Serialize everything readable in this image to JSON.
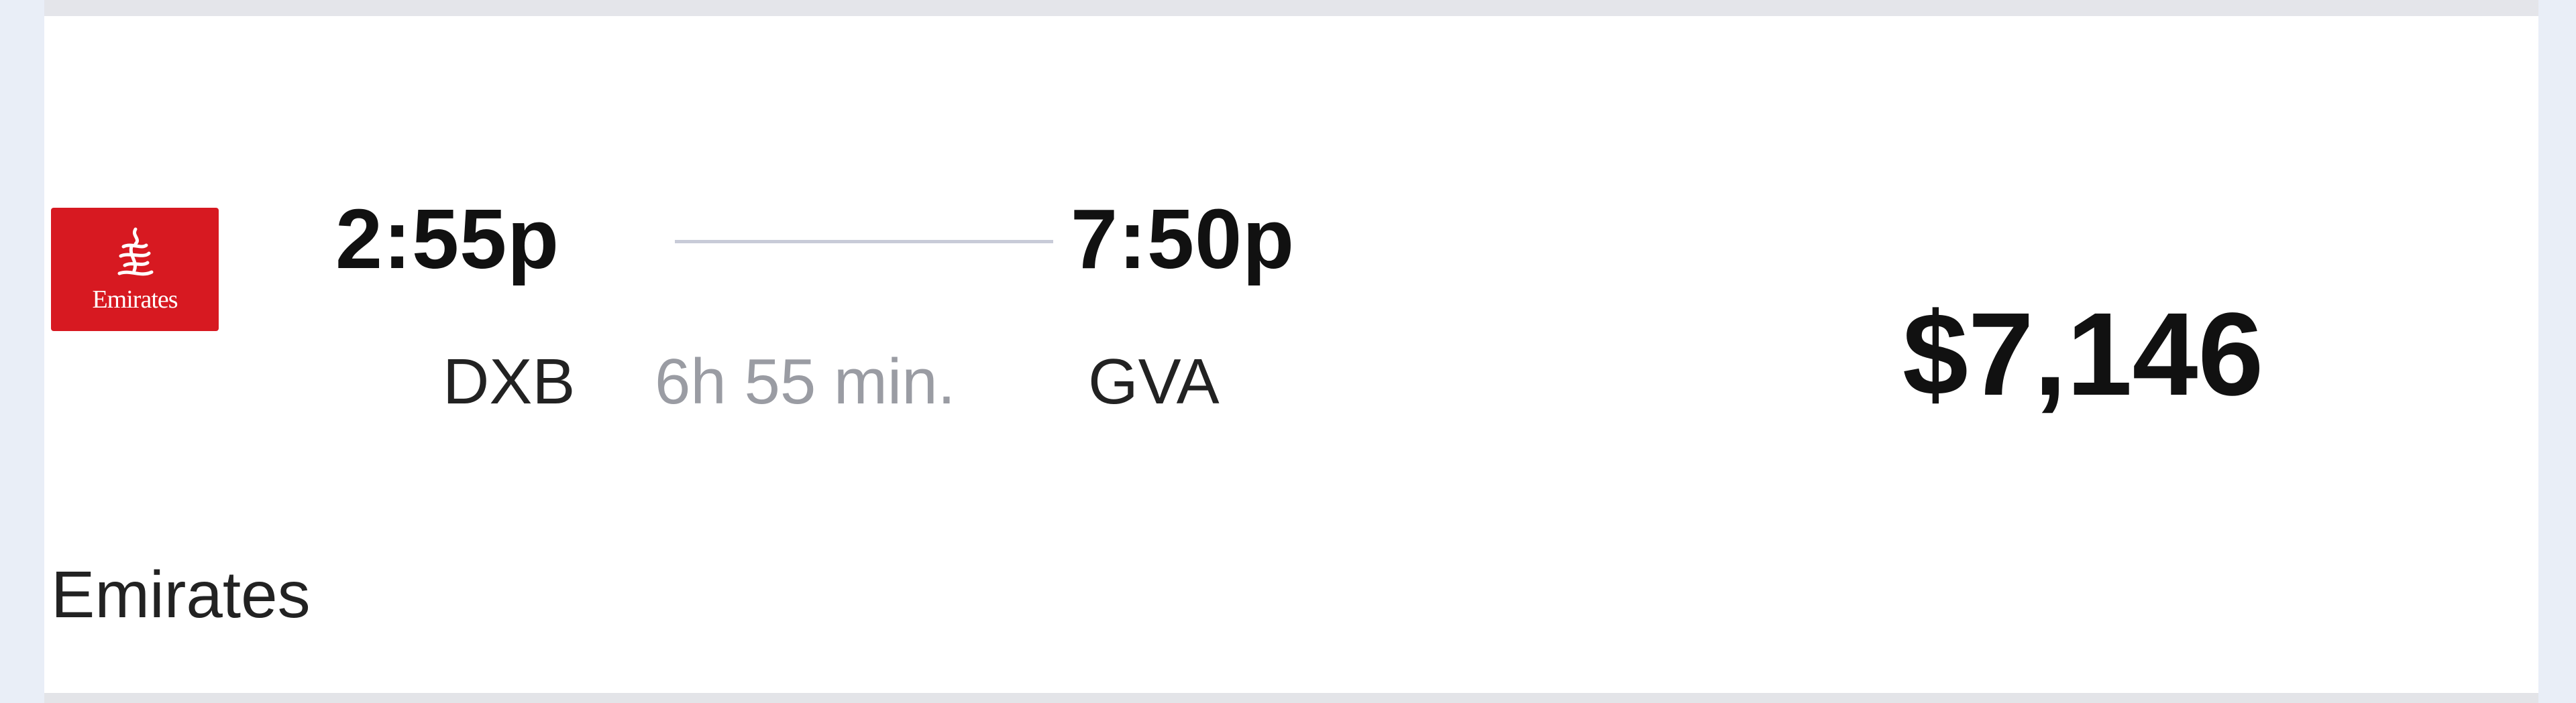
{
  "flight": {
    "logo": {
      "text": "Emirates",
      "icon": "emirates-logo",
      "background": "#d71921"
    },
    "departure": {
      "time": "2:55p",
      "airport": "DXB"
    },
    "arrival": {
      "time": "7:50p",
      "airport": "GVA"
    },
    "duration": "6h 55 min.",
    "price": "$7,146",
    "airline": "Emirates"
  }
}
